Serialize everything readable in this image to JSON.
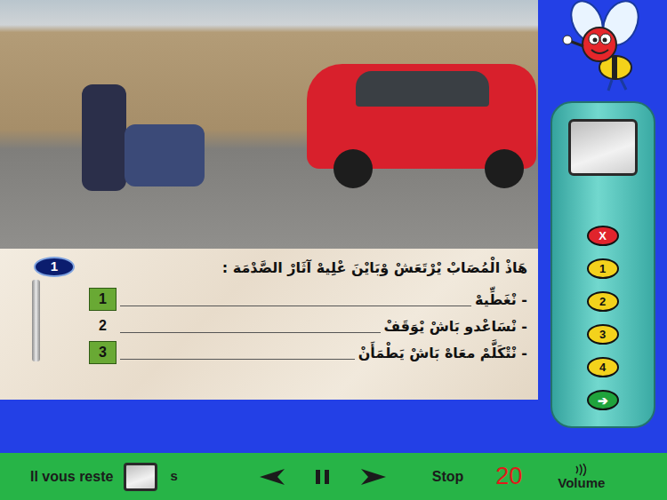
{
  "question": {
    "number": "1",
    "text": "هَاذْ الْمُصَابْ يْرْتَعَشْ وْبَايْنَ عْلِيهْ آثَارْ الصَّدْمَة :"
  },
  "answers": [
    {
      "number": "1",
      "text": "- نْغَطِّيهْ",
      "selected": true
    },
    {
      "number": "2",
      "text": "- نْسَاعْدو بَاشْ يْوَقَفْ",
      "selected": false
    },
    {
      "number": "3",
      "text": "- نْتْكَلَّمْ معَاهْ بَاشْ يَطْمَأَنْ",
      "selected": true
    }
  ],
  "remote": {
    "buttons": [
      {
        "label": "X",
        "kind": "cancel"
      },
      {
        "label": "1",
        "kind": "number"
      },
      {
        "label": "2",
        "kind": "number"
      },
      {
        "label": "3",
        "kind": "number"
      },
      {
        "label": "4",
        "kind": "number"
      },
      {
        "label": "➔",
        "kind": "confirm"
      }
    ]
  },
  "bottom_bar": {
    "time_label": "Il vous reste",
    "time_unit": "s",
    "stop": "Stop",
    "counter": "20",
    "volume": "Volume"
  }
}
